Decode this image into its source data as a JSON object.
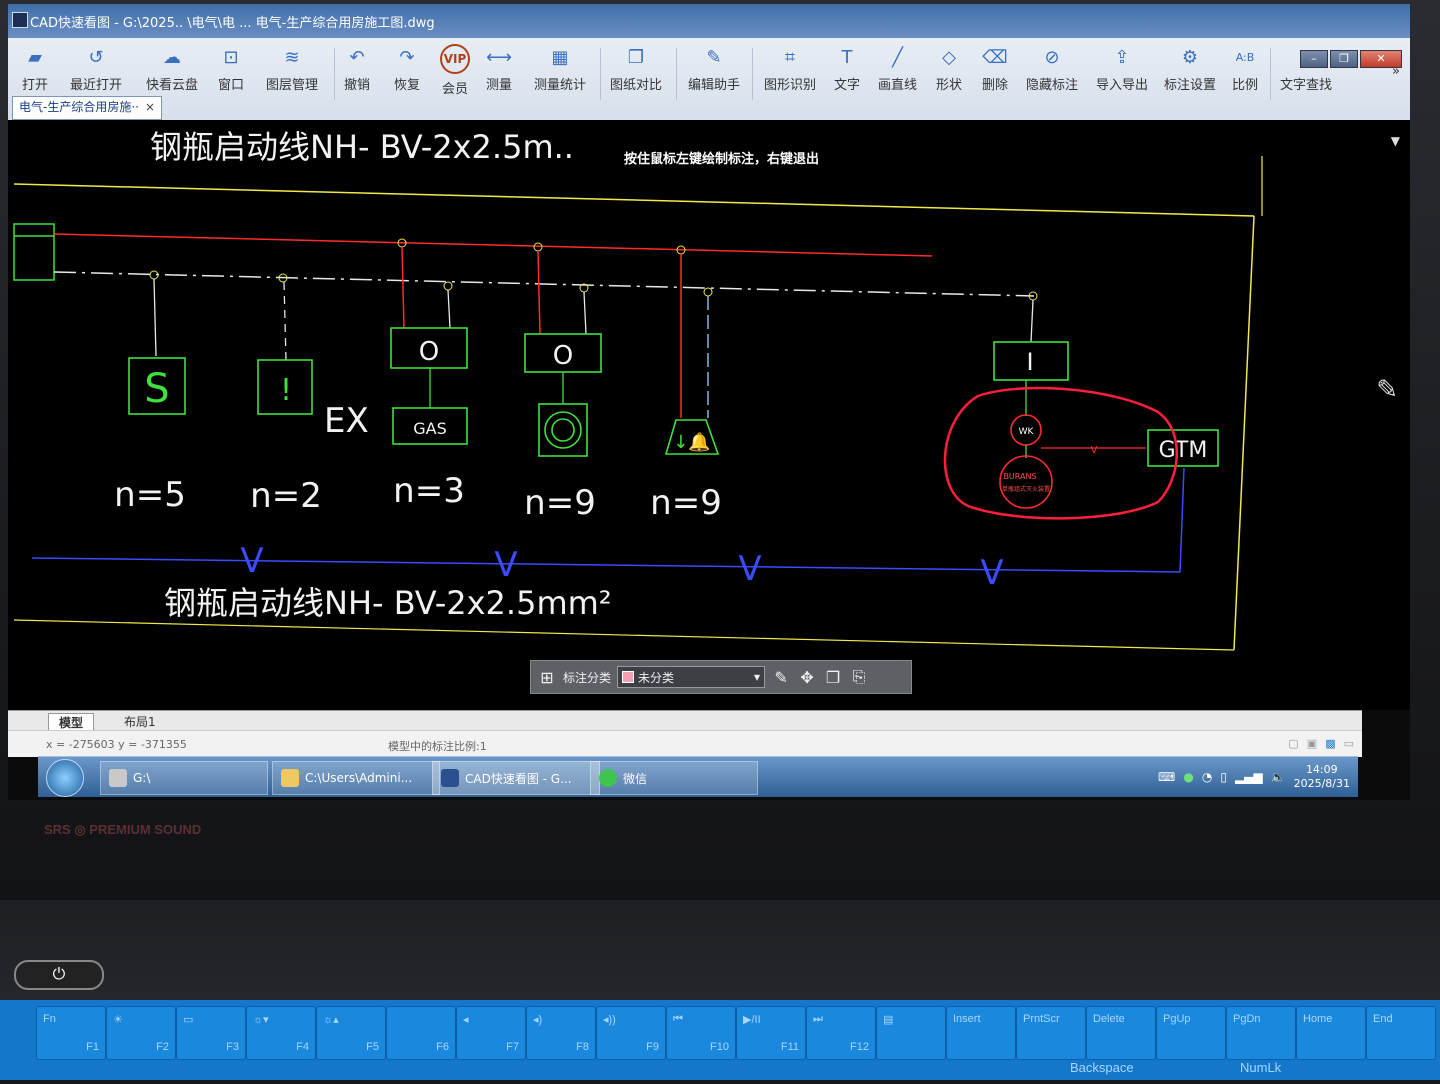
{
  "window": {
    "title": "CAD快速看图 - G:\\2025.. \\电气\\电 ... 电气-生产综合用房施工图.dwg",
    "controls": [
      "–",
      "❐",
      "✕"
    ]
  },
  "toolbar": {
    "items": [
      {
        "label": "打开",
        "icon": "folder-icon"
      },
      {
        "label": "最近打开",
        "icon": "history-icon"
      },
      {
        "label": "快看云盘",
        "icon": "cloud-icon"
      },
      {
        "label": "窗口",
        "icon": "window-icon"
      },
      {
        "label": "图层管理",
        "icon": "layers-icon"
      },
      {
        "label": "撤销",
        "icon": "undo-icon"
      },
      {
        "label": "恢复",
        "icon": "redo-icon"
      },
      {
        "label": "会员",
        "icon": "vip-icon"
      },
      {
        "label": "测量",
        "icon": "measure-icon"
      },
      {
        "label": "测量统计",
        "icon": "measure-stats-icon"
      },
      {
        "label": "图纸对比",
        "icon": "compare-icon"
      },
      {
        "label": "编辑助手",
        "icon": "edit-assistant-icon"
      },
      {
        "label": "图形识别",
        "icon": "shape-recognize-icon"
      },
      {
        "label": "文字",
        "icon": "text-icon"
      },
      {
        "label": "画直线",
        "icon": "line-icon"
      },
      {
        "label": "形状",
        "icon": "shape-icon"
      },
      {
        "label": "删除",
        "icon": "eraser-icon"
      },
      {
        "label": "隐藏标注",
        "icon": "hide-annotation-icon"
      },
      {
        "label": "导入导出",
        "icon": "import-export-icon"
      },
      {
        "label": "标注设置",
        "icon": "annotation-settings-icon"
      },
      {
        "label": "比例",
        "icon": "scale-icon"
      },
      {
        "label": "文字查找",
        "icon": "text-search-icon"
      }
    ],
    "more": "»"
  },
  "doc_tab": {
    "label": "电气-生产综合用房施··",
    "close": "×"
  },
  "canvas": {
    "hint": "按住鼠标左键绘制标注，右键退出",
    "top_cable_label": "钢瓶启动线NH- BV-2x2.5m..",
    "bottom_cable_label": "钢瓶启动线NH- BV-2x2.5mm²",
    "devices": [
      {
        "symbol": "S",
        "count": "n=5"
      },
      {
        "symbol": "!",
        "extra": "EX",
        "count": "n=2"
      },
      {
        "symbol": "O",
        "sub": "GAS",
        "count": "n=3"
      },
      {
        "symbol": "O",
        "sub": "◎",
        "count": "n=9"
      },
      {
        "symbol": "bell",
        "count": "n=9"
      },
      {
        "symbol": "I",
        "sub_top": "WK",
        "sub_bottom": "BURANS",
        "sub_bottom_small": "单瓶组式灭火装置",
        "side": "GTM",
        "wire_mark": "V"
      }
    ],
    "bus_marks": [
      "V",
      "V",
      "V",
      "V"
    ],
    "colors": {
      "bus_red": "#ff2b2b",
      "bus_white": "#e8e8e8",
      "bus_blue": "#3b4bff",
      "frame_yellow": "#f0e94a",
      "device_green": "#3fe03f",
      "annotation_red": "#ff1f3d"
    }
  },
  "annotation_bar": {
    "category_label": "标注分类",
    "category_value": "未分类"
  },
  "layout_tabs": {
    "model": "模型",
    "layout1": "布局1"
  },
  "status": {
    "coords": "x = -275603  y = -371355",
    "scale": "模型中的标注比例:1"
  },
  "taskbar": {
    "tasks": [
      {
        "label": "G:\\"
      },
      {
        "label": "C:\\Users\\Admini..."
      },
      {
        "label": "CAD快速看图 - G..."
      },
      {
        "label": "微信"
      }
    ],
    "time": "14:09",
    "date": "2025/8/31"
  },
  "laptop": {
    "brand": "SRS ◎ PREMIUM SOUND",
    "fn_keys": [
      {
        "top": "Fn",
        "bottom": "F1"
      },
      {
        "top": "☀",
        "bottom": "F2"
      },
      {
        "top": "▭",
        "bottom": "F3"
      },
      {
        "top": "☼▾",
        "bottom": "F4"
      },
      {
        "top": "☼▴",
        "bottom": "F5"
      },
      {
        "top": "",
        "bottom": "F6"
      },
      {
        "top": "◂",
        "bottom": "F7"
      },
      {
        "top": "◂)",
        "bottom": "F8"
      },
      {
        "top": "◂))",
        "bottom": "F9"
      },
      {
        "top": "⏮",
        "bottom": "F10"
      },
      {
        "top": "▶/II",
        "bottom": "F11"
      },
      {
        "top": "⏭",
        "bottom": "F12"
      },
      {
        "top": "▤",
        "bottom": ""
      },
      {
        "top": "Insert",
        "bottom": ""
      },
      {
        "top": "PrntScr",
        "bottom": ""
      },
      {
        "top": "Delete",
        "bottom": ""
      },
      {
        "top": "PgUp",
        "bottom": ""
      },
      {
        "top": "PgDn",
        "bottom": ""
      },
      {
        "top": "Home",
        "bottom": ""
      },
      {
        "top": "End",
        "bottom": ""
      }
    ],
    "backspace": "Backspace",
    "numlk": "NumLk"
  }
}
